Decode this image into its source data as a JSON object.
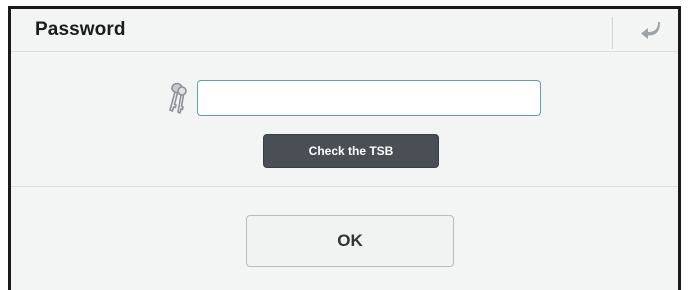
{
  "dialog": {
    "title": "Password",
    "back_icon": "return-arrow-icon"
  },
  "form": {
    "key_icon": "keys-icon",
    "password_value": "",
    "password_placeholder": "",
    "tsb_button_label": "Check the TSB"
  },
  "footer": {
    "ok_label": "OK"
  },
  "colors": {
    "background": "#f3f4f4",
    "input_border": "#5aa2ae",
    "tsb_button_bg": "#4a4f55",
    "frame_border": "#1a1a1a"
  }
}
